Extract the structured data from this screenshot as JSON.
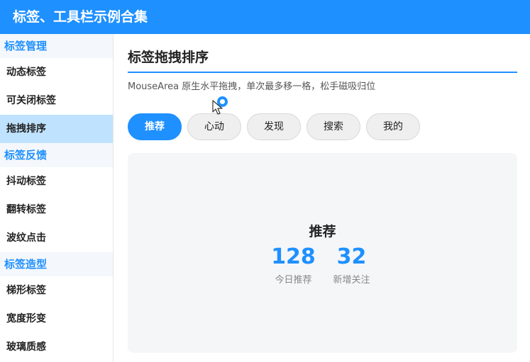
{
  "window": {
    "title": "标签、工具栏示例合集"
  },
  "sidebar": {
    "groups": [
      {
        "title": "标签管理",
        "items": [
          {
            "label": "动态标签"
          },
          {
            "label": "可关闭标签"
          },
          {
            "label": "拖拽排序"
          }
        ]
      },
      {
        "title": "标签反馈",
        "items": [
          {
            "label": "抖动标签"
          },
          {
            "label": "翻转标签"
          },
          {
            "label": "波纹点击"
          }
        ]
      },
      {
        "title": "标签造型",
        "items": [
          {
            "label": "梯形标签"
          },
          {
            "label": "宽度形变"
          },
          {
            "label": "玻璃质感"
          }
        ]
      }
    ],
    "active_item": "拖拽排序"
  },
  "main": {
    "title": "标签拖拽排序",
    "subtitle": "MouseArea 原生水平拖拽，单次最多移一格，松手磁吸归位",
    "tabs": [
      {
        "label": "推荐"
      },
      {
        "label": "心动"
      },
      {
        "label": "发现"
      },
      {
        "label": "搜索"
      },
      {
        "label": "我的"
      }
    ],
    "active_tab": "推荐",
    "panel": {
      "title": "推荐",
      "stats": [
        {
          "value": "128",
          "label": "今日推荐"
        },
        {
          "value": "32",
          "label": "新增关注"
        }
      ]
    }
  },
  "colors": {
    "accent": "#1e90ff",
    "active_bg": "#bfe3ff",
    "panel_bg": "#f5f6f8"
  },
  "icons": {
    "cursor": "arrow-cursor-icon",
    "drag": "drag-indicator-icon"
  }
}
